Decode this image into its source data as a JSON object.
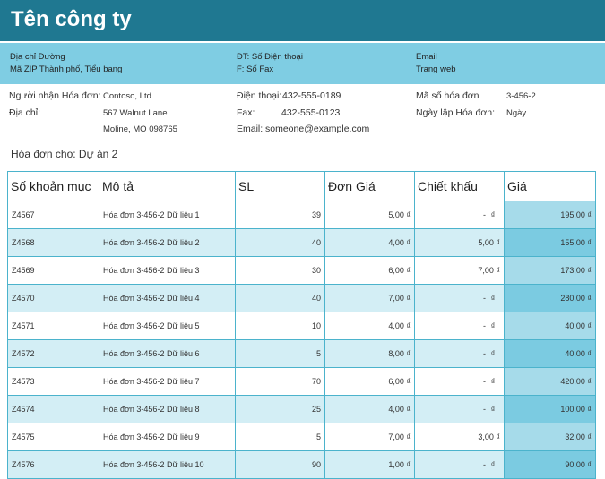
{
  "company": {
    "name": "Tên công ty"
  },
  "address_band": {
    "street": "Địa chỉ Đường",
    "city_line": "Mã ZIP Thành phố, Tiểu bang",
    "phone": "ĐT: Số Điện thoại",
    "fax": "F: Số Fax",
    "email": "Email",
    "website": "Trang web"
  },
  "recipient": {
    "label": "Người nhận Hóa đơn:",
    "name": "Contoso, Ltd",
    "address_label": "Địa chỉ:",
    "address_line1": "567 Walnut Lane",
    "address_line2": "Moline, MO 098765"
  },
  "contact": {
    "phone_label": "Điện thoại:",
    "phone": "432-555-0189",
    "fax_label": "Fax:",
    "fax": "432-555-0123",
    "email_label": "Email:",
    "email": "someone@example.com"
  },
  "invoice_meta": {
    "number_label": "Mã số hóa đơn",
    "number": "3-456-2",
    "date_label": "Ngày lập Hóa đơn:",
    "date": "Ngày"
  },
  "bill_for": "Hóa đơn cho: Dự án 2",
  "table": {
    "headers": [
      "Số khoản mục",
      "Mô tả",
      "SL",
      "Đơn Giá",
      "Chiết khấu",
      "Giá"
    ],
    "rows": [
      [
        "Z4567",
        "Hóa đơn 3-456-2 Dữ liệu 1",
        "39",
        "5,00 ₫",
        "-",
        "195,00 ₫"
      ],
      [
        "Z4568",
        "Hóa đơn 3-456-2 Dữ liệu 2",
        "40",
        "4,00 ₫",
        "5,00 ₫",
        "155,00 ₫"
      ],
      [
        "Z4569",
        "Hóa đơn 3-456-2 Dữ liệu 3",
        "30",
        "6,00 ₫",
        "7,00 ₫",
        "173,00 ₫"
      ],
      [
        "Z4570",
        "Hóa đơn 3-456-2 Dữ liệu 4",
        "40",
        "7,00 ₫",
        "-",
        "280,00 ₫"
      ],
      [
        "Z4571",
        "Hóa đơn 3-456-2 Dữ liệu 5",
        "10",
        "4,00 ₫",
        "-",
        "40,00 ₫"
      ],
      [
        "Z4572",
        "Hóa đơn 3-456-2 Dữ liệu 6",
        "5",
        "8,00 ₫",
        "-",
        "40,00 ₫"
      ],
      [
        "Z4573",
        "Hóa đơn 3-456-2 Dữ liệu 7",
        "70",
        "6,00 ₫",
        "-",
        "420,00 ₫"
      ],
      [
        "Z4574",
        "Hóa đơn 3-456-2 Dữ liệu 8",
        "25",
        "4,00 ₫",
        "-",
        "100,00 ₫"
      ],
      [
        "Z4575",
        "Hóa đơn 3-456-2 Dữ liệu 9",
        "5",
        "7,00 ₫",
        "3,00 ₫",
        "32,00 ₫"
      ],
      [
        "Z4576",
        "Hóa đơn 3-456-2 Dữ liệu 10",
        "90",
        "1,00 ₫",
        "-",
        "90,00 ₫"
      ]
    ]
  }
}
